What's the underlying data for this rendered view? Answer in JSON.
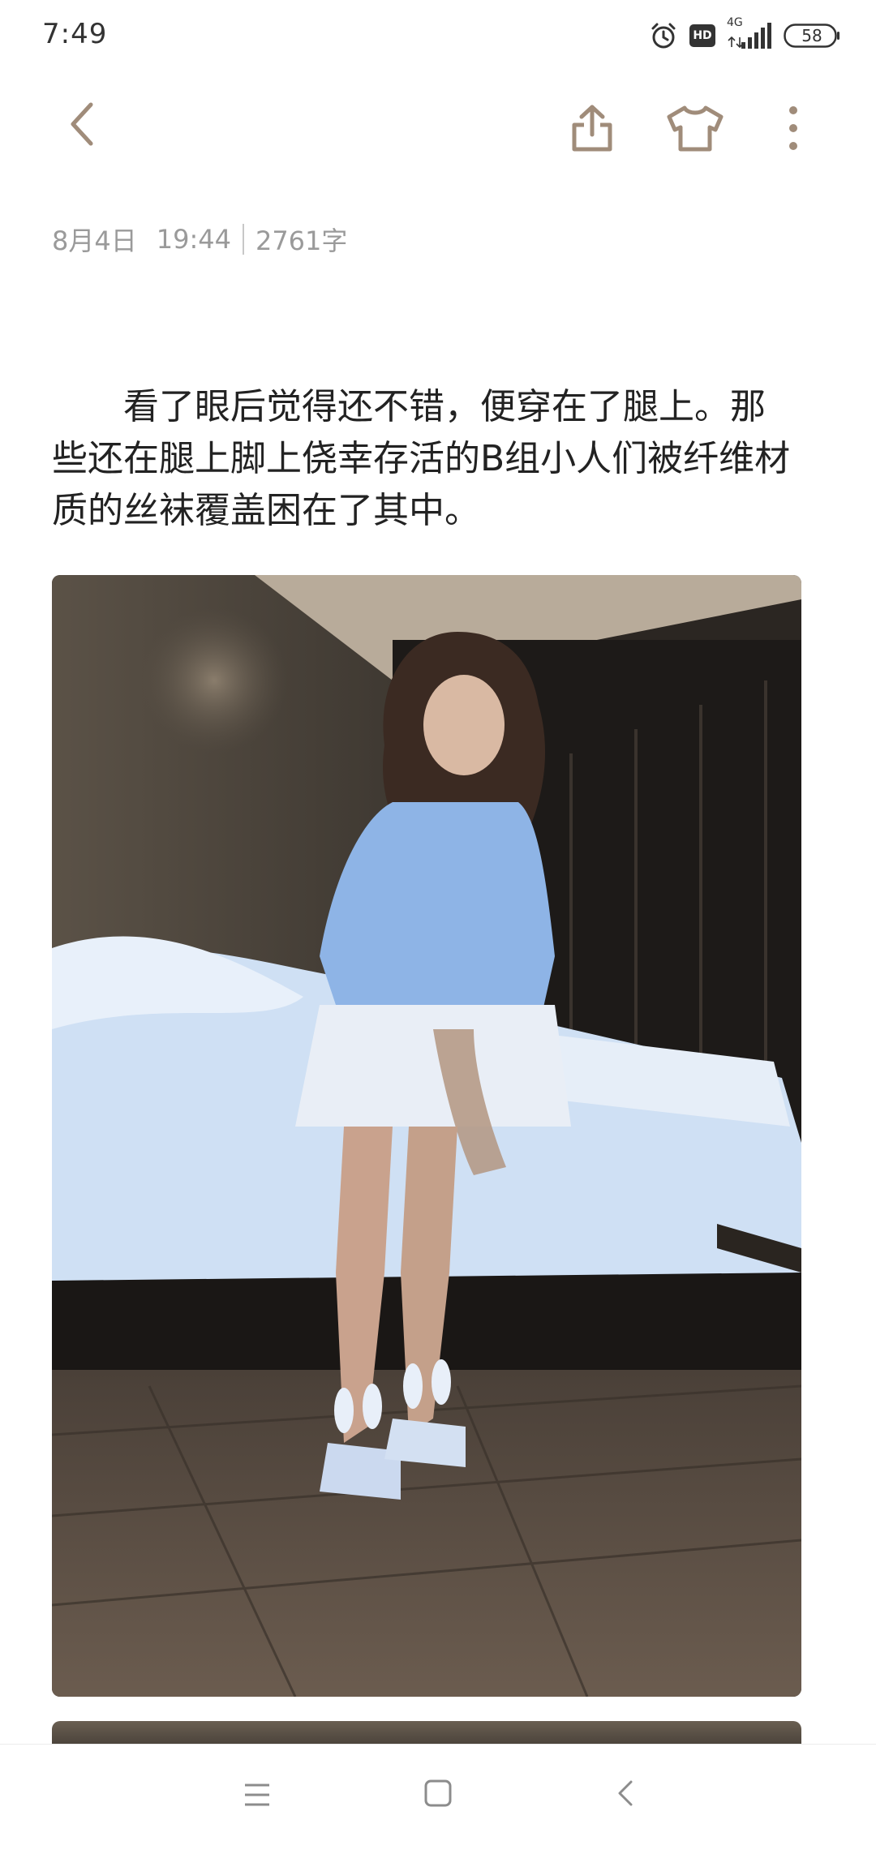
{
  "status_bar": {
    "time": "7:49",
    "network": "4G",
    "hd": "HD",
    "battery": "58"
  },
  "toolbar": {
    "back_icon": "chevron-left-icon",
    "share_icon": "share-icon",
    "theme_icon": "tshirt-icon",
    "more_icon": "more-vertical-icon",
    "icon_color": "#a08c7a"
  },
  "meta": {
    "date": "8月4日",
    "time": "19:44",
    "word_count": "2761字"
  },
  "article": {
    "paragraph": "看了眼后觉得还不错，便穿在了腿上。那些还在腿上脚上侥幸存活的B组小人们被纤维材质的丝袜覆盖困在了其中。"
  },
  "nav_bar": {
    "menu_icon": "menu-icon",
    "home_icon": "square-home-icon",
    "back_icon": "back-triangle-icon"
  }
}
